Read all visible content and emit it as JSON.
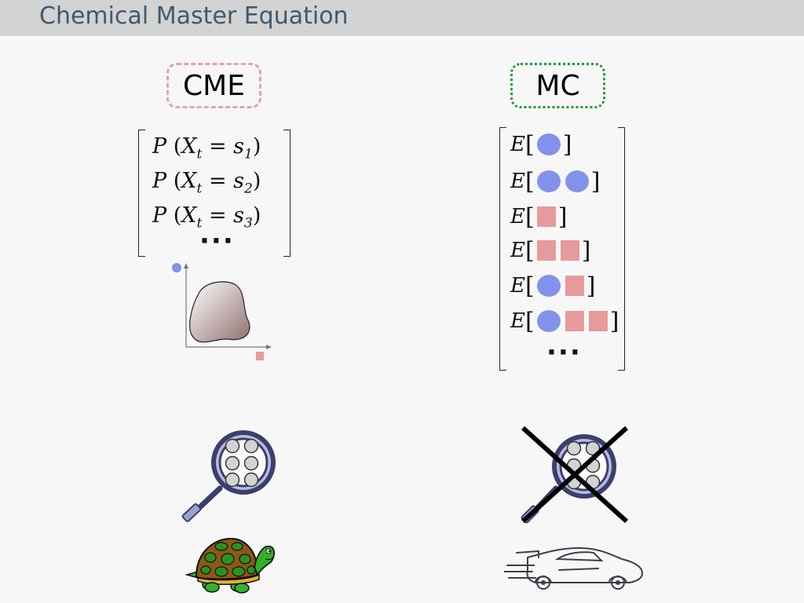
{
  "header": {
    "title": "Chemical Master Equation"
  },
  "cme": {
    "label": "CME",
    "prob_rows": [
      {
        "sub": "1"
      },
      {
        "sub": "2"
      },
      {
        "sub": "3"
      }
    ],
    "ellipsis": "···"
  },
  "mc": {
    "label": "MC",
    "expectations": [
      {
        "shapes": [
          "circle"
        ]
      },
      {
        "shapes": [
          "circle",
          "circle"
        ]
      },
      {
        "shapes": [
          "square"
        ]
      },
      {
        "shapes": [
          "square",
          "square"
        ]
      },
      {
        "shapes": [
          "circle",
          "square"
        ]
      },
      {
        "shapes": [
          "circle",
          "square",
          "square"
        ]
      }
    ],
    "ellipsis": "···"
  },
  "colors": {
    "species_circle": "#8292ea",
    "species_square": "#e79a9b",
    "cme_border": "#e4a4aa",
    "mc_border": "#1f9a31"
  },
  "icons": {
    "cme_state_plot": "probability-blob-icon",
    "cme_magnifier": "magnifier-icon",
    "cme_speed": "turtle-icon",
    "mc_magnifier": "magnifier-icon",
    "mc_cross": "cross-icon",
    "mc_speed": "sports-car-icon"
  }
}
